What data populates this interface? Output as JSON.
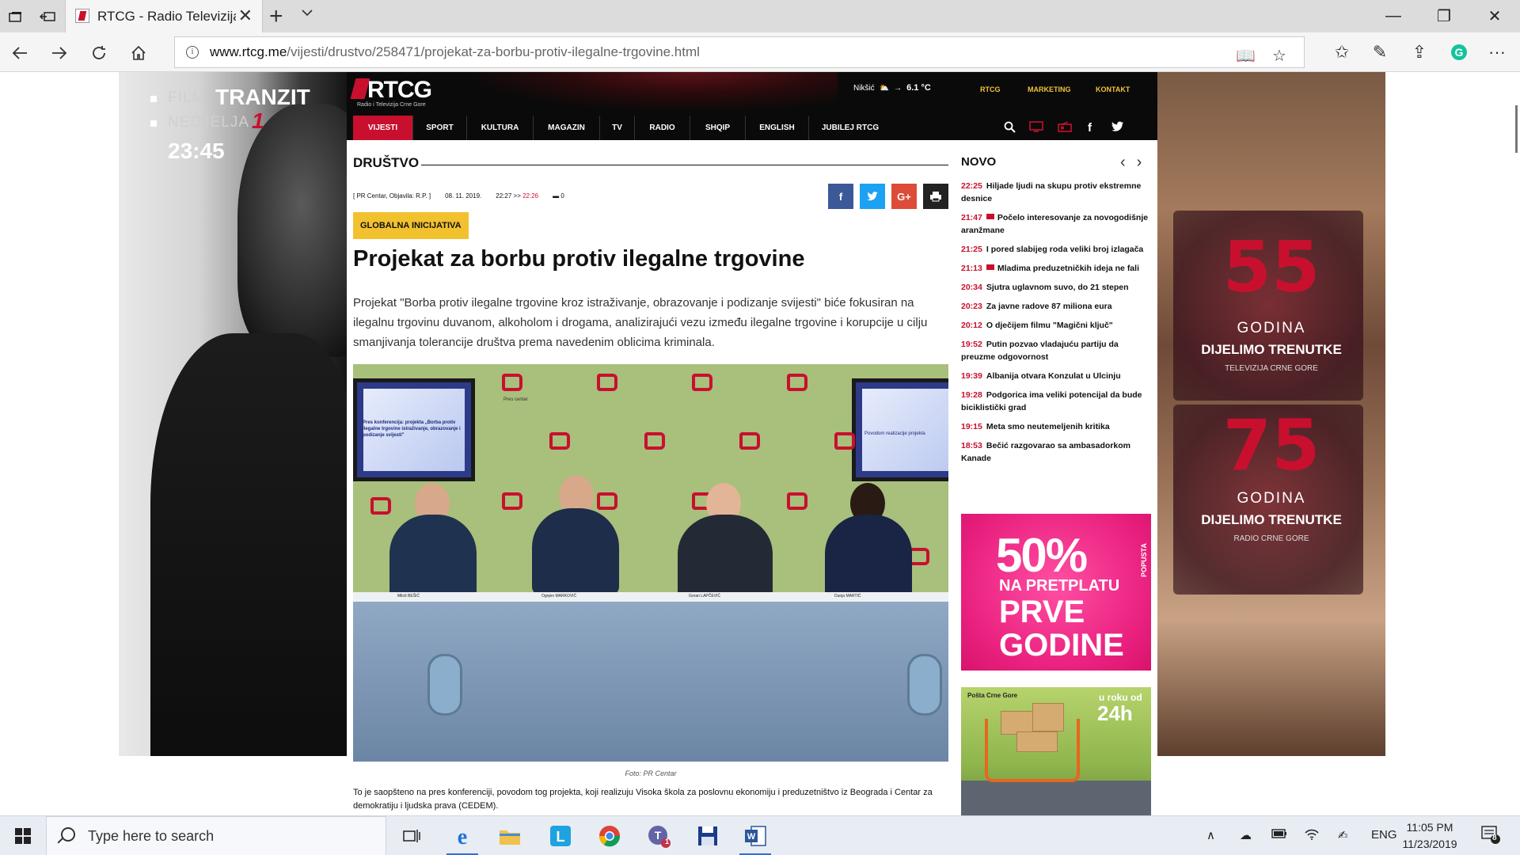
{
  "browser": {
    "tab_title": "RTCG - Radio Televizija Crne Gore",
    "url_host": "www.rtcg.me",
    "url_path": "/vijesti/drustvo/258471/projekat-za-borbu-protiv-ilegalne-trgovine.html"
  },
  "site": {
    "logo_text": "RTCG",
    "logo_sub": "Radio i Televizija Crne Gore",
    "weather_city": "Nikšić",
    "weather_temp": "6.1 °C",
    "top_links": [
      "RTCG",
      "MARKETING",
      "KONTAKT"
    ],
    "nav": [
      "VIJESTI",
      "SPORT",
      "KULTURA",
      "MAGAZIN",
      "TV",
      "RADIO",
      "SHQIP",
      "ENGLISH",
      "JUBILEJ RTCG"
    ],
    "nav_active": "VIJESTI"
  },
  "article": {
    "section": "DRUŠTVO",
    "source": "[ PR Centar, Objavila: R.P. ]",
    "date": "08. 11. 2019.",
    "time_published": "22:27",
    "time_arrow": ">>",
    "time_updated": "22:26",
    "comments": "0",
    "tag": "GLOBALNA INICIJATIVA",
    "headline": "Projekat za borbu protiv ilegalne trgovine",
    "lead": "Projekat \"Borba protiv ilegalne trgovine kroz istraživanje, obrazovanje i podizanje svijesti\" biće fokusiran na ilegalnu trgovinu duvanom, alkoholom i drogama, analizirajući vezu između ilegalne trgovine i korupcije u cilju smanjivanja tolerancije društva prema navedenim oblicima kriminala.",
    "photo_caption": "Foto: PR Centar",
    "body": "To je saopšteno na pres konferenciji, povodom tog projekta, koji realizuju Visoka škola za poslovnu ekonomiju i preduzetništvo iz Beograda i Centar za demokratiju i ljudska prava (CEDEM).",
    "share": [
      "f",
      "t",
      "G+",
      "print"
    ],
    "photo_text": {
      "screen_left": "Pres konferencija: projekta „Borba protiv ilegalne trgovine istraživanje, obrazovanje i podizanje svijesti\"",
      "screen_right": "Povodom realizacije projekta",
      "pres_centar": "Pres centar",
      "nameplates": [
        "Miloš BEŠIĆ",
        "Ognjen MARKOVIĆ",
        "Goran LAPČEVIĆ",
        "Dunja MARTIĆ"
      ]
    }
  },
  "sidebar": {
    "title": "NOVO",
    "news": [
      {
        "time": "22:25",
        "title": "Hiljade ljudi na skupu protiv ekstremne desnice",
        "video": false
      },
      {
        "time": "21:47",
        "title": "Počelo interesovanje za novogodišnje aranžmane",
        "video": true
      },
      {
        "time": "21:25",
        "title": "I pored slabijeg roda veliki broj izlagača",
        "video": false
      },
      {
        "time": "21:13",
        "title": "Mladima preduzetničkih ideja ne fali",
        "video": true
      },
      {
        "time": "20:34",
        "title": "Sjutra uglavnom suvo, do 21 stepen",
        "video": false
      },
      {
        "time": "20:23",
        "title": "Za javne radove 87 miliona eura",
        "video": false
      },
      {
        "time": "20:12",
        "title": "O dječijem filmu \"Magični ključ\"",
        "video": false
      },
      {
        "time": "19:52",
        "title": "Putin pozvao vladajuću partiju da preuzme odgovornost",
        "video": false
      },
      {
        "time": "19:39",
        "title": "Albanija otvara Konzulat u Ulcinju",
        "video": false
      },
      {
        "time": "19:28",
        "title": "Podgorica ima veliki potencijal da bude biciklistički grad",
        "video": false
      },
      {
        "time": "19:15",
        "title": "Meta smo neutemeljenih kritika",
        "video": false
      },
      {
        "time": "18:53",
        "title": "Bečić razgovarao sa ambasadorkom Kanade",
        "video": false
      }
    ],
    "promo1": {
      "big": "50%",
      "popusta": "POPUSTA",
      "l2": "NA PRETPLATU",
      "l3": "PRVE",
      "l4": "GODINE"
    },
    "promo2": {
      "logo": "Pošta Crne Gore",
      "r1": "u roku od",
      "r2": "24h"
    }
  },
  "ads": {
    "left": {
      "l1a": "FILM",
      "l1b": "TRANZIT",
      "l2a": "NEDJELJA",
      "l2b": "1",
      "time": "23:45"
    },
    "right": {
      "n1": "55",
      "g1": "GODINA",
      "d1": "DIJELIMO TRENUTKE",
      "s1": "TELEVIZIJA CRNE GORE",
      "n2": "75",
      "g2": "GODINA",
      "d2": "DIJELIMO TRENUTKE",
      "s2": "RADIO CRNE GORE"
    }
  },
  "taskbar": {
    "search_placeholder": "Type here to search",
    "lang": "ENG",
    "time": "11:05 PM",
    "date": "11/23/2019",
    "notifications": "8",
    "teams_badge": "1"
  },
  "colors": {
    "brand_red": "#c8102e",
    "tag_yellow": "#f2c12e",
    "facebook": "#3b5998",
    "twitter": "#1da1f2",
    "gplus": "#dd4b39"
  }
}
